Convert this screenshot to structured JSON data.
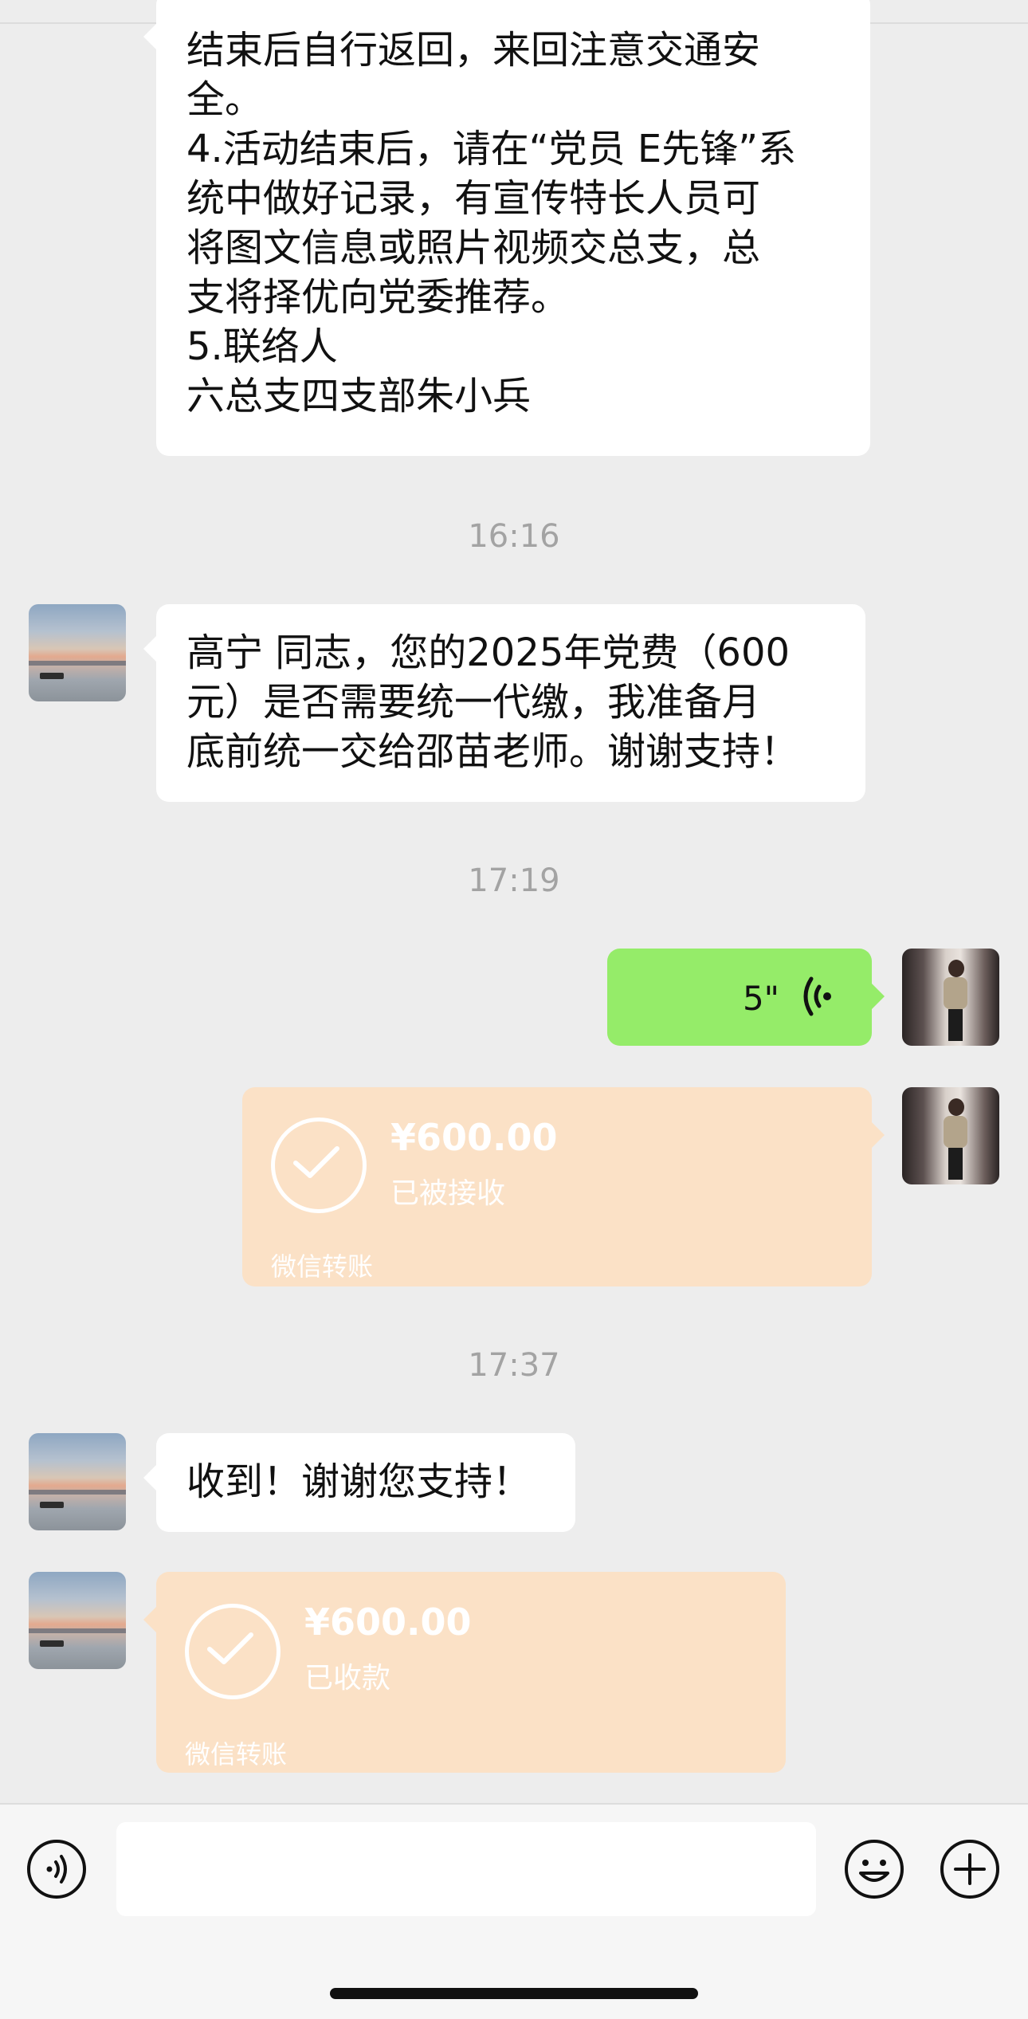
{
  "messages": {
    "m1_text": "结束后自行返回，来回注意交通安\n全。\n4.活动结束后，请在“党员 E先锋”系\n统中做好记录，有宣传特长人员可\n将图文信息或照片视频交总支，总\n支将择优向党委推荐。\n5.联络人\n六总支四支部朱小兵",
    "time1": "16:16",
    "m2_text": "高宁 同志，您的2025年党费（600\n元）是否需要统一代缴，我准备月\n底前统一交给邵苗老师。谢谢支持！",
    "time2": "17:19",
    "voice_duration": "5\"",
    "transfer1": {
      "amount": "¥600.00",
      "status": "已被接收",
      "brand": "微信转账"
    },
    "time3": "17:37",
    "m3_text": "收到！谢谢您支持！",
    "transfer2": {
      "amount": "¥600.00",
      "status": "已收款",
      "brand": "微信转账"
    }
  },
  "input_bar": {
    "voice_icon": "voice-toggle-icon",
    "emoji_icon": "emoji-icon",
    "plus_icon": "plus-icon"
  },
  "colors": {
    "background": "#ededed",
    "self_bubble": "#95ec69",
    "transfer": "#fbe1c6",
    "timestamp": "#a3a3a3"
  }
}
